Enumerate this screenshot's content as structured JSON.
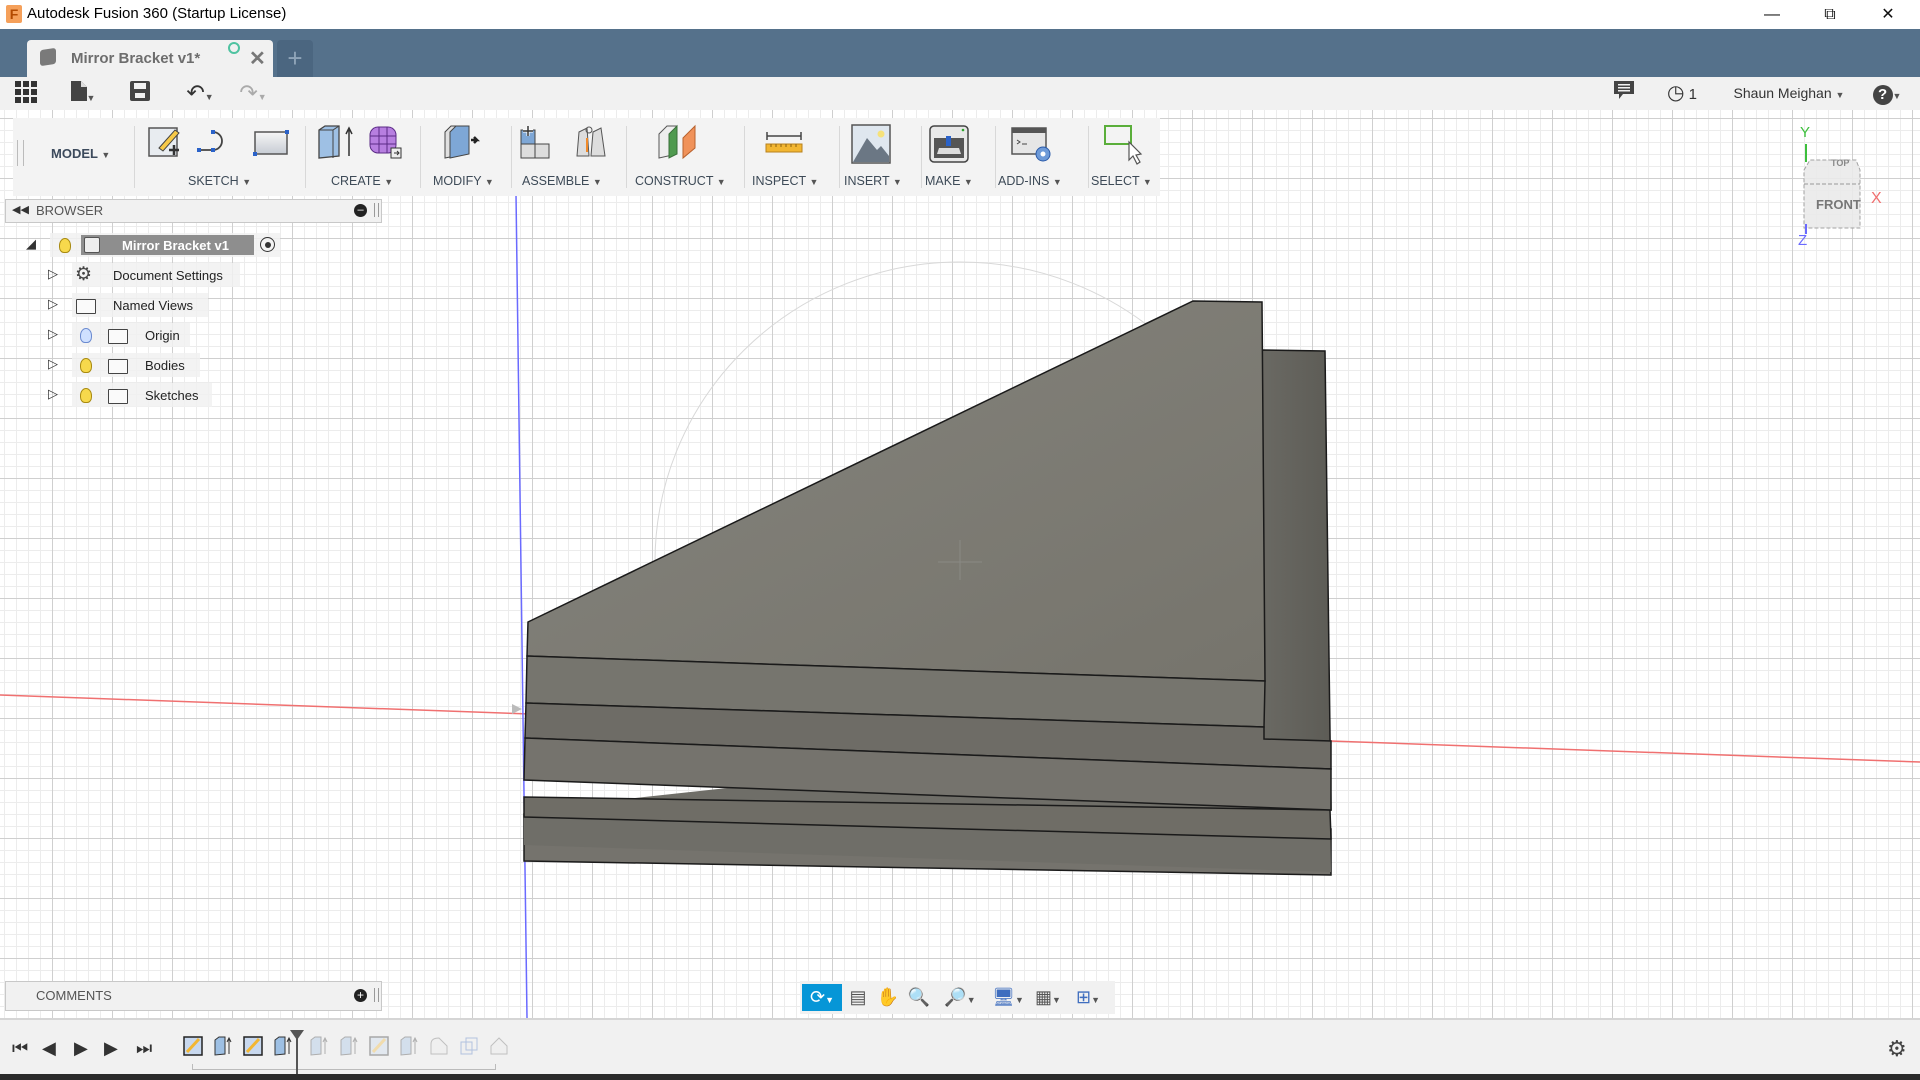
{
  "window": {
    "app_icon": "F",
    "title": "Autodesk Fusion 360 (Startup License)",
    "controls": [
      "minimize-icon",
      "restore-icon",
      "close-icon"
    ]
  },
  "tabs": {
    "active": {
      "label": "Mirror Bracket v1*",
      "icon": "document-cube-icon",
      "status": "unsaved-sync-circle"
    },
    "new_tab_label": "+"
  },
  "quick_access": {
    "items": [
      "data-panel-grid-icon",
      "file-icon",
      "save-icon",
      "undo-icon",
      "redo-icon"
    ],
    "jobs_count": "1",
    "user": "Shaun Meighan",
    "help_label": "?"
  },
  "ribbon": {
    "workspace": "MODEL",
    "groups": [
      {
        "label": "SKETCH",
        "icons": [
          "create-sketch-icon",
          "line-arc-icon",
          "rectangle-icon"
        ]
      },
      {
        "label": "CREATE",
        "icons": [
          "extrude-icon",
          "form-icon"
        ]
      },
      {
        "label": "MODIFY",
        "icons": [
          "press-pull-icon"
        ]
      },
      {
        "label": "ASSEMBLE",
        "icons": [
          "new-component-icon",
          "joint-icon"
        ]
      },
      {
        "label": "CONSTRUCT",
        "icons": [
          "offset-plane-icon"
        ]
      },
      {
        "label": "INSPECT",
        "icons": [
          "measure-icon"
        ]
      },
      {
        "label": "INSERT",
        "icons": [
          "insert-image-icon"
        ]
      },
      {
        "label": "MAKE",
        "icons": [
          "3d-print-icon"
        ]
      },
      {
        "label": "ADD-INS",
        "icons": [
          "scripts-addins-icon"
        ]
      },
      {
        "label": "SELECT",
        "icons": [
          "select-window-icon"
        ]
      }
    ]
  },
  "browser": {
    "title": "BROWSER",
    "root": {
      "label": "Mirror Bracket v1"
    },
    "items": [
      {
        "label": "Document Settings",
        "icon": "gear-icon",
        "visibility": null
      },
      {
        "label": "Named Views",
        "icon": "folder-icon",
        "visibility": null
      },
      {
        "label": "Origin",
        "icon": "folder-icon",
        "visibility": "hidden"
      },
      {
        "label": "Bodies",
        "icon": "folder-icon",
        "visibility": "visible"
      },
      {
        "label": "Sketches",
        "icon": "folder-icon",
        "visibility": "visible"
      }
    ]
  },
  "comments": {
    "title": "COMMENTS"
  },
  "viewcube": {
    "top": "TOP",
    "front": "FRONT",
    "axes": {
      "x": "X",
      "y": "Y",
      "z": "Z"
    }
  },
  "navbar": {
    "items": [
      "orbit-icon",
      "look-at-icon",
      "pan-icon",
      "zoom-icon",
      "fit-icon",
      "display-settings-icon",
      "grid-settings-icon",
      "viewports-icon"
    ],
    "active": "orbit-icon"
  },
  "timeline": {
    "controls": [
      "go-to-start-icon",
      "step-back-icon",
      "play-icon",
      "step-forward-icon",
      "go-to-end-icon"
    ],
    "features": [
      {
        "type": "sketch",
        "active": true
      },
      {
        "type": "extrude",
        "active": true
      },
      {
        "type": "sketch",
        "active": true
      },
      {
        "type": "extrude",
        "active": true
      },
      {
        "type": "extrude",
        "active": false
      },
      {
        "type": "extrude",
        "active": false
      },
      {
        "type": "sketch",
        "active": false
      },
      {
        "type": "extrude",
        "active": false
      },
      {
        "type": "fillet",
        "active": false
      },
      {
        "type": "mirror",
        "active": false
      },
      {
        "type": "chamfer",
        "active": false
      }
    ],
    "marker_after_feature": 4
  },
  "colors": {
    "tabbar": "#55718b",
    "body": "#7a7870",
    "x_axis": "#f07070",
    "y_axis": "#3cbf3c",
    "z_axis": "#6a6aff",
    "nav_active": "#0696d7"
  }
}
